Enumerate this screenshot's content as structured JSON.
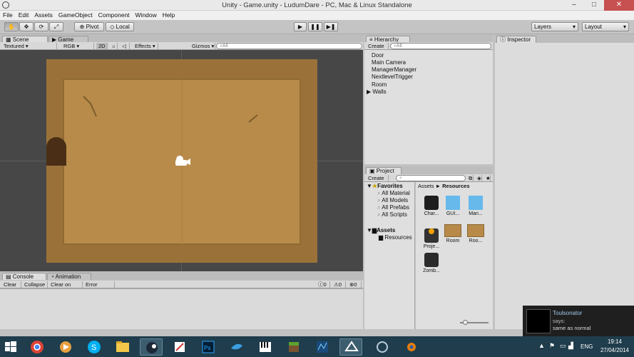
{
  "window": {
    "title": "Unity - Game.unity - LudumDare - PC, Mac & Linux Standalone",
    "minimize": "–",
    "maximize": "□",
    "close": "✕"
  },
  "menu": [
    "File",
    "Edit",
    "Assets",
    "GameObject",
    "Component",
    "Window",
    "Help"
  ],
  "toolbar": {
    "pivot": "Pivot",
    "local": "Local",
    "layers": "Layers",
    "layout": "Layout"
  },
  "scene": {
    "tabs": [
      "Scene",
      "Game"
    ],
    "shading": "Textured",
    "rgb": "RGB",
    "mode2d": "2D",
    "effects": "Effects",
    "gizmos": "Gizmos",
    "search_placeholder": "All"
  },
  "hierarchy": {
    "tab": "Hierarchy",
    "create": "Create",
    "search_placeholder": "All",
    "items": [
      "Door",
      "Main Camera",
      "ManagerManager",
      "NextlevelTrigger",
      "Room",
      "Walls"
    ]
  },
  "project": {
    "tab": "Project",
    "create": "Create",
    "favorites_label": "Favorites",
    "favorites": [
      "All Material",
      "All Models",
      "All Prefabs",
      "All Scripts"
    ],
    "assets_label": "Assets",
    "assets_children": [
      "Resources"
    ],
    "breadcrumb": {
      "root": "Assets",
      "sep": "►",
      "current": "Resources"
    },
    "items": [
      {
        "name": "Char..."
      },
      {
        "name": "GUI..."
      },
      {
        "name": "Man..."
      },
      {
        "name": "Proje..."
      },
      {
        "name": "Room"
      },
      {
        "name": "Roo..."
      },
      {
        "name": "Zomb..."
      }
    ]
  },
  "console": {
    "tabs": [
      "Console",
      "Animation"
    ],
    "buttons": [
      "Clear",
      "Collapse",
      "Clear on Play",
      "Error Pause"
    ],
    "counts": [
      "0",
      "0",
      "0"
    ]
  },
  "inspector": {
    "tab": "Inspector"
  },
  "notification": {
    "user": "Toulsonator",
    "says": "says:",
    "message": "same as normal"
  },
  "tray": {
    "lang": "ENG",
    "time": "19:14",
    "date": "27/04/2014"
  },
  "colors": {
    "room_floor": "#b78a49",
    "scene_bg": "#474747",
    "taskbar": "#1f3d4c"
  }
}
